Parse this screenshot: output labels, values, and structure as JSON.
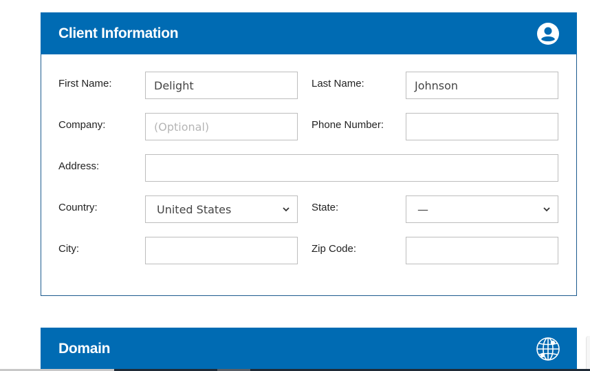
{
  "client_panel": {
    "title": "Client Information",
    "icon": "user-circle-icon",
    "fields": {
      "first_name": {
        "label": "First Name:",
        "value": "Delight",
        "placeholder": ""
      },
      "last_name": {
        "label": "Last Name:",
        "value": "Johnson",
        "placeholder": ""
      },
      "company": {
        "label": "Company:",
        "value": "",
        "placeholder": "(Optional)"
      },
      "phone": {
        "label": "Phone Number:",
        "value": "",
        "placeholder": ""
      },
      "address": {
        "label": "Address:",
        "value": "",
        "placeholder": ""
      },
      "country": {
        "label": "Country:",
        "selected": "United States"
      },
      "state": {
        "label": "State:",
        "selected": "—"
      },
      "city": {
        "label": "City:",
        "value": "",
        "placeholder": ""
      },
      "zip": {
        "label": "Zip Code:",
        "value": "",
        "placeholder": ""
      }
    }
  },
  "domain_panel": {
    "title": "Domain",
    "icon": "globe-icon"
  },
  "colors": {
    "header_blue": "#006bb3",
    "panel_border": "#1b5a8e",
    "field_border": "#bdbdbd"
  }
}
